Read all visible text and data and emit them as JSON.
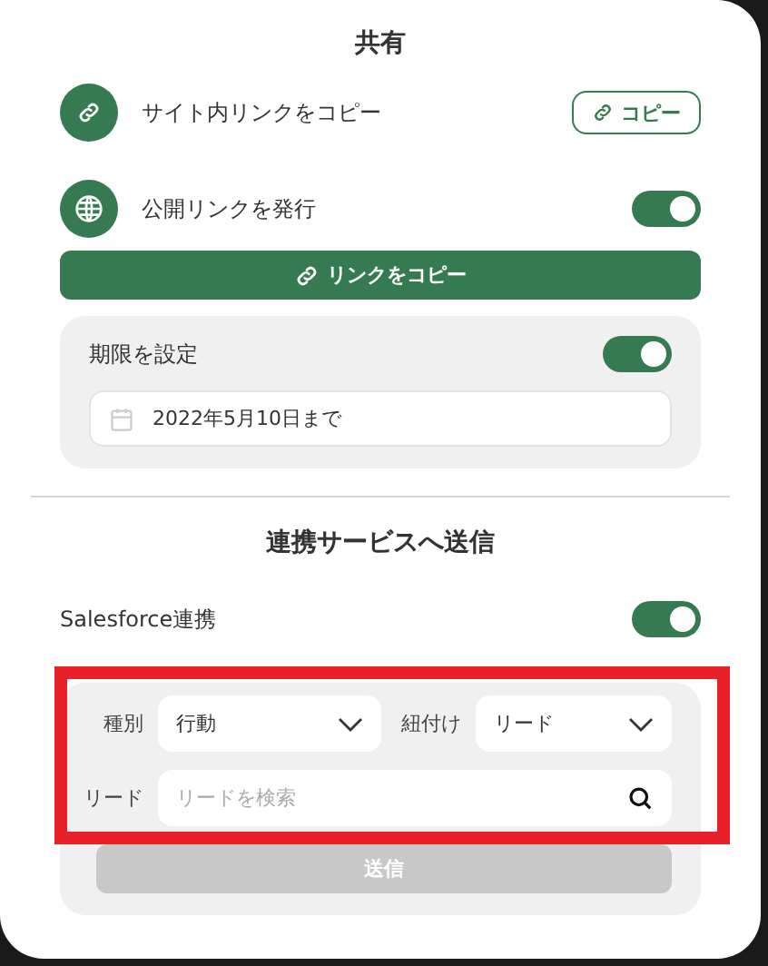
{
  "share": {
    "title": "共有",
    "site_link": {
      "label": "サイト内リンクをコピー",
      "button": "コピー"
    },
    "public_link": {
      "label": "公開リンクを発行",
      "on": true,
      "button": "リンクをコピー"
    },
    "expiry": {
      "label": "期限を設定",
      "on": true,
      "date": "2022年5月10日まで"
    }
  },
  "integration": {
    "title": "連携サービスへ送信",
    "salesforce": {
      "label": "Salesforce連携",
      "on": true
    },
    "type": {
      "label": "種別",
      "value": "行動"
    },
    "link_to": {
      "label": "紐付け",
      "value": "リード"
    },
    "lead": {
      "label": "リード",
      "placeholder": "リードを検索"
    },
    "send": {
      "label": "送信",
      "disabled": true
    }
  },
  "highlight": {
    "shown": true
  }
}
